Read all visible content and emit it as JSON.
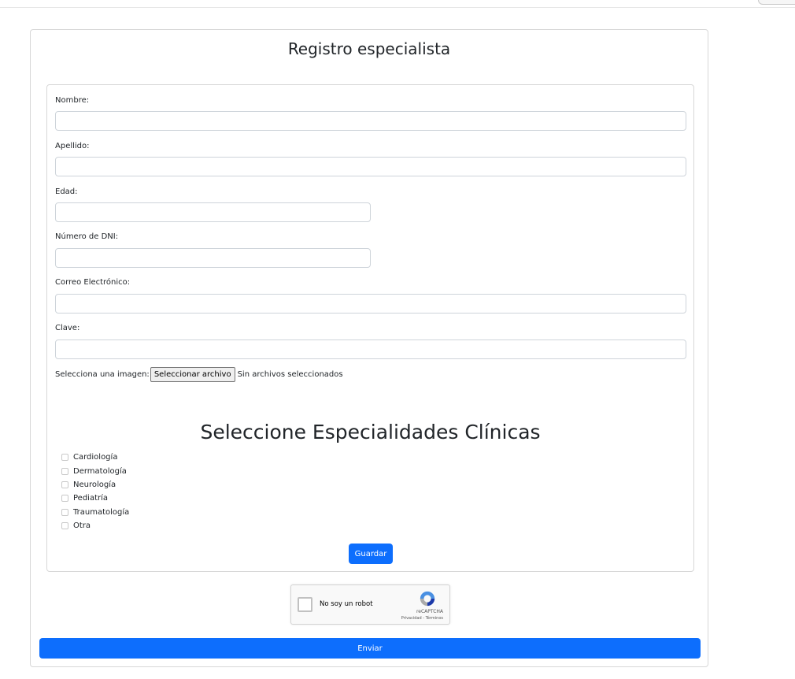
{
  "form": {
    "title": "Registro especialista",
    "fields": [
      {
        "label": "Nombre:",
        "value": ""
      },
      {
        "label": "Apellido:",
        "value": ""
      },
      {
        "label": "Edad:",
        "value": ""
      },
      {
        "label": "Número de DNI:",
        "value": ""
      },
      {
        "label": "Correo Electrónico:",
        "value": ""
      },
      {
        "label": "Clave:",
        "value": ""
      }
    ],
    "file": {
      "label": "Selecciona una imagen:",
      "button": "Seleccionar archivo",
      "status": "Sin archivos seleccionados"
    },
    "specialties_title": "Seleccione Especialidades Clínicas",
    "specialties": [
      {
        "label": "Cardiología",
        "checked": false
      },
      {
        "label": "Dermatología",
        "checked": false
      },
      {
        "label": "Neurología",
        "checked": false
      },
      {
        "label": "Pediatría",
        "checked": false
      },
      {
        "label": "Traumatología",
        "checked": false
      },
      {
        "label": "Otra",
        "checked": false
      }
    ],
    "save_label": "Guardar"
  },
  "recaptcha": {
    "label": "No soy un robot",
    "brand": "reCAPTCHA",
    "terms": "Privacidad - Términos",
    "icon": "recaptcha-logo-icon"
  },
  "send_label": "Enviar",
  "colors": {
    "primary": "#0d6efd",
    "border": "#d7d7d7"
  }
}
